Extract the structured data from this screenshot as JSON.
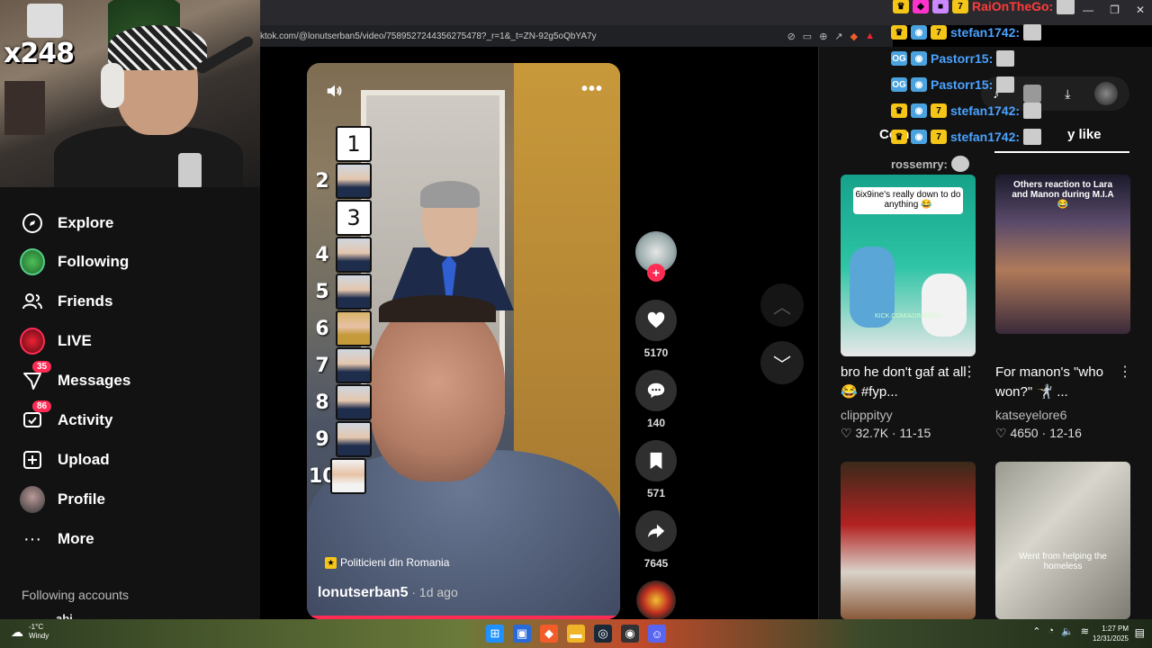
{
  "browser": {
    "url": "ktok.com/@lonutserban5/video/7589527244356275478?_r=1&_t=ZN-92g5oQbYA7y"
  },
  "webcam": {
    "overlay_text": "x248"
  },
  "sidebar": {
    "items": [
      {
        "label": "Explore",
        "icon": "compass-icon"
      },
      {
        "label": "Following",
        "icon": "following-avatar-icon"
      },
      {
        "label": "Friends",
        "icon": "friends-icon"
      },
      {
        "label": "LIVE",
        "icon": "live-icon"
      },
      {
        "label": "Messages",
        "icon": "messages-icon",
        "badge": "35"
      },
      {
        "label": "Activity",
        "icon": "activity-icon",
        "badge": "86"
      },
      {
        "label": "Upload",
        "icon": "upload-icon"
      },
      {
        "label": "Profile",
        "icon": "profile-avatar-icon"
      },
      {
        "label": "More",
        "icon": "more-icon"
      }
    ],
    "following_accounts_label": "Following accounts",
    "following_partial": "abi"
  },
  "video": {
    "ranking": [
      "1",
      "2",
      "3",
      "4",
      "5",
      "6",
      "7",
      "8",
      "9",
      "10"
    ],
    "tag": "Politicieni din Romania",
    "author": "lonutserban5",
    "age": " · 1d ago"
  },
  "actions": {
    "likes": "5170",
    "comments": "140",
    "saves": "571",
    "shares": "7645"
  },
  "right_panel": {
    "tab_comments_partial": "Com",
    "tab_maylike_partial": "y like",
    "videos": [
      {
        "caption": "6ix9ine's really down to do anything 😂",
        "overlay": "KICK.COM/ADINROSS",
        "title": "bro he don't gaf at all 😂 #fyp...",
        "user": "clipppityy",
        "likes": "32.7K",
        "date": "11-15"
      },
      {
        "caption": "Others reaction to Lara and Manon during M.I.A😂",
        "title": "For manon's \"who won?\" 🤺 ...",
        "user": "katseyelore6",
        "likes": "4650",
        "date": "12-16"
      },
      {
        "caption": ""
      },
      {
        "caption": "Went from helping the homeless"
      }
    ]
  },
  "chat": [
    {
      "user": "RaiOnTheGo:",
      "color": "#ff3b3b"
    },
    {
      "user": "stefan1742:",
      "color": "#4aa3ff"
    },
    {
      "user": "Pastorr15:",
      "color": "#4aa3ff"
    },
    {
      "user": "Pastorr15:",
      "color": "#4aa3ff"
    },
    {
      "user": "stefan1742:",
      "color": "#4aa3ff"
    },
    {
      "user": "stefan1742:",
      "color": "#4aa3ff"
    },
    {
      "user": "rossemry:",
      "color": "#bbbbbb"
    }
  ],
  "taskbar": {
    "temp": "-1°C",
    "weather": "Windy",
    "time": "1:27 PM",
    "date": "12/31/2025"
  },
  "colors": {
    "accent": "#fe2c55",
    "bg": "#121212"
  }
}
